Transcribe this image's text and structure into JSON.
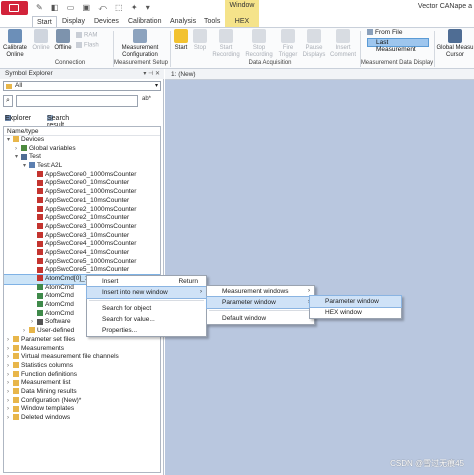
{
  "titlebar": {
    "window_context": "Window",
    "app_title": "Vector CANape a"
  },
  "tabs": [
    "Start",
    "Display",
    "Devices",
    "Calibration",
    "Analysis",
    "Tools",
    "HEX"
  ],
  "ribbon": {
    "calibration_online": "Calibrate\nOnline",
    "online": "Online",
    "offline": "Offline",
    "ram": "RAM",
    "flash": "Flash",
    "group_connection": "Connection",
    "measurement_config": "Measurement\nConfiguration",
    "group_meas_setup": "Measurement Setup",
    "start": "Start",
    "stop": "Stop",
    "start_recording": "Start\nRecording",
    "stop_recording": "Stop\nRecording",
    "fire_trigger": "Fire\nTrigger",
    "pause_displays": "Pause\nDisplays",
    "insert_comment": "Insert\nComment",
    "group_data_acq": "Data Acquisition",
    "from_file": "From File",
    "last_measurement": "Last Measurement",
    "group_meas_display": "Measurement Data Display",
    "global_meas_cursor": "Global Measu\nCursor"
  },
  "symbol_explorer": {
    "title": "Symbol Explorer",
    "filter_value": "All",
    "search_placeholder": "",
    "ab_label": "ab*",
    "tab_explorer": "Explorer",
    "tab_search": "Search result",
    "column_header": "Name/type"
  },
  "tree": [
    {
      "label": "Devices",
      "indent": 0,
      "exp": "▾",
      "icon": "folder"
    },
    {
      "label": "Global variables",
      "indent": 1,
      "exp": "›",
      "icon": "var"
    },
    {
      "label": "Test",
      "indent": 1,
      "exp": "▾",
      "icon": "device"
    },
    {
      "label": "Test:A2L",
      "indent": 2,
      "exp": "▾",
      "icon": "a2l"
    },
    {
      "label": "AppSwcCore0_1000msCounter",
      "indent": 3,
      "exp": "",
      "icon": "sig"
    },
    {
      "label": "AppSwcCore0_10msCounter",
      "indent": 3,
      "exp": "",
      "icon": "sig"
    },
    {
      "label": "AppSwcCore1_1000msCounter",
      "indent": 3,
      "exp": "",
      "icon": "sig"
    },
    {
      "label": "AppSwcCore1_10msCounter",
      "indent": 3,
      "exp": "",
      "icon": "sig"
    },
    {
      "label": "AppSwcCore2_1000msCounter",
      "indent": 3,
      "exp": "",
      "icon": "sig"
    },
    {
      "label": "AppSwcCore2_10msCounter",
      "indent": 3,
      "exp": "",
      "icon": "sig"
    },
    {
      "label": "AppSwcCore3_1000msCounter",
      "indent": 3,
      "exp": "",
      "icon": "sig"
    },
    {
      "label": "AppSwcCore3_10msCounter",
      "indent": 3,
      "exp": "",
      "icon": "sig"
    },
    {
      "label": "AppSwcCore4_1000msCounter",
      "indent": 3,
      "exp": "",
      "icon": "sig"
    },
    {
      "label": "AppSwcCore4_10msCounter",
      "indent": 3,
      "exp": "",
      "icon": "sig"
    },
    {
      "label": "AppSwcCore5_1000msCounter",
      "indent": 3,
      "exp": "",
      "icon": "sig"
    },
    {
      "label": "AppSwcCore5_10msCounter",
      "indent": 3,
      "exp": "",
      "icon": "sig"
    },
    {
      "label": "AtomCmd[0]_10",
      "indent": 3,
      "exp": "",
      "icon": "sig",
      "selected": true
    },
    {
      "label": "AtomCmd",
      "indent": 3,
      "exp": "",
      "icon": "sig2"
    },
    {
      "label": "AtomCmd",
      "indent": 3,
      "exp": "",
      "icon": "sig2"
    },
    {
      "label": "AtomCmd",
      "indent": 3,
      "exp": "",
      "icon": "sig2"
    },
    {
      "label": "AtomCmd",
      "indent": 3,
      "exp": "",
      "icon": "sig2"
    },
    {
      "label": "Software",
      "indent": 3,
      "exp": "›",
      "icon": "sw"
    },
    {
      "label": "User-defined",
      "indent": 2,
      "exp": "›",
      "icon": "folder"
    },
    {
      "label": "Parameter set files",
      "indent": 0,
      "exp": "›",
      "icon": "folder"
    },
    {
      "label": "Measurements",
      "indent": 0,
      "exp": "›",
      "icon": "folder"
    },
    {
      "label": "Virtual measurement file channels",
      "indent": 0,
      "exp": "›",
      "icon": "folder"
    },
    {
      "label": "Statistics columns",
      "indent": 0,
      "exp": "›",
      "icon": "folder"
    },
    {
      "label": "Function definitions",
      "indent": 0,
      "exp": "›",
      "icon": "folder"
    },
    {
      "label": "Measurement list",
      "indent": 0,
      "exp": "›",
      "icon": "folder"
    },
    {
      "label": "Data Mining results",
      "indent": 0,
      "exp": "›",
      "icon": "folder"
    },
    {
      "label": "Configuration (New)*",
      "indent": 0,
      "exp": "›",
      "icon": "folder"
    },
    {
      "label": "Window templates",
      "indent": 0,
      "exp": "›",
      "icon": "folder"
    },
    {
      "label": "Deleted windows",
      "indent": 0,
      "exp": "›",
      "icon": "folder"
    }
  ],
  "main_tab": "1: (New)",
  "context_menu": [
    {
      "label": "Insert",
      "shortcut": "Return"
    },
    {
      "label": "Insert into new window",
      "arrow": "›",
      "highlight": true
    },
    {
      "sep": true
    },
    {
      "label": "Search for object"
    },
    {
      "label": "Search for value..."
    },
    {
      "label": "Properties..."
    }
  ],
  "submenu1": [
    {
      "label": "Measurement windows",
      "arrow": "›"
    },
    {
      "label": "Parameter window",
      "arrow": "›",
      "highlight": true
    },
    {
      "sep": true
    },
    {
      "label": "Default window"
    }
  ],
  "submenu2": [
    {
      "label": "Parameter window",
      "highlight": true
    },
    {
      "label": "HEX window"
    }
  ],
  "watermark": "CSDN @雪过无痕45",
  "colors": {
    "accent": "#d2233a",
    "selection": "#cce4f7",
    "workspace": "#b9c7df",
    "ctx_yellow": "#f5e38a"
  }
}
